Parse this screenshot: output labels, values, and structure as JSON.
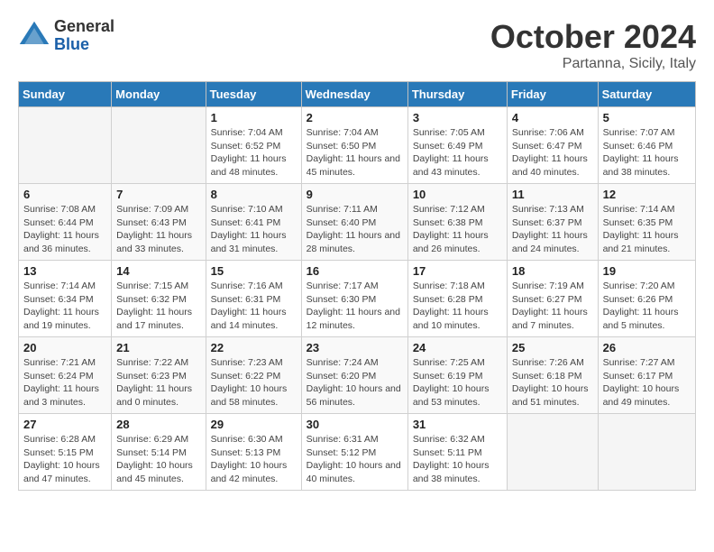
{
  "logo": {
    "general": "General",
    "blue": "Blue"
  },
  "title": "October 2024",
  "subtitle": "Partanna, Sicily, Italy",
  "headers": [
    "Sunday",
    "Monday",
    "Tuesday",
    "Wednesday",
    "Thursday",
    "Friday",
    "Saturday"
  ],
  "weeks": [
    [
      {
        "day": "",
        "info": ""
      },
      {
        "day": "",
        "info": ""
      },
      {
        "day": "1",
        "info": "Sunrise: 7:04 AM\nSunset: 6:52 PM\nDaylight: 11 hours and 48 minutes."
      },
      {
        "day": "2",
        "info": "Sunrise: 7:04 AM\nSunset: 6:50 PM\nDaylight: 11 hours and 45 minutes."
      },
      {
        "day": "3",
        "info": "Sunrise: 7:05 AM\nSunset: 6:49 PM\nDaylight: 11 hours and 43 minutes."
      },
      {
        "day": "4",
        "info": "Sunrise: 7:06 AM\nSunset: 6:47 PM\nDaylight: 11 hours and 40 minutes."
      },
      {
        "day": "5",
        "info": "Sunrise: 7:07 AM\nSunset: 6:46 PM\nDaylight: 11 hours and 38 minutes."
      }
    ],
    [
      {
        "day": "6",
        "info": "Sunrise: 7:08 AM\nSunset: 6:44 PM\nDaylight: 11 hours and 36 minutes."
      },
      {
        "day": "7",
        "info": "Sunrise: 7:09 AM\nSunset: 6:43 PM\nDaylight: 11 hours and 33 minutes."
      },
      {
        "day": "8",
        "info": "Sunrise: 7:10 AM\nSunset: 6:41 PM\nDaylight: 11 hours and 31 minutes."
      },
      {
        "day": "9",
        "info": "Sunrise: 7:11 AM\nSunset: 6:40 PM\nDaylight: 11 hours and 28 minutes."
      },
      {
        "day": "10",
        "info": "Sunrise: 7:12 AM\nSunset: 6:38 PM\nDaylight: 11 hours and 26 minutes."
      },
      {
        "day": "11",
        "info": "Sunrise: 7:13 AM\nSunset: 6:37 PM\nDaylight: 11 hours and 24 minutes."
      },
      {
        "day": "12",
        "info": "Sunrise: 7:14 AM\nSunset: 6:35 PM\nDaylight: 11 hours and 21 minutes."
      }
    ],
    [
      {
        "day": "13",
        "info": "Sunrise: 7:14 AM\nSunset: 6:34 PM\nDaylight: 11 hours and 19 minutes."
      },
      {
        "day": "14",
        "info": "Sunrise: 7:15 AM\nSunset: 6:32 PM\nDaylight: 11 hours and 17 minutes."
      },
      {
        "day": "15",
        "info": "Sunrise: 7:16 AM\nSunset: 6:31 PM\nDaylight: 11 hours and 14 minutes."
      },
      {
        "day": "16",
        "info": "Sunrise: 7:17 AM\nSunset: 6:30 PM\nDaylight: 11 hours and 12 minutes."
      },
      {
        "day": "17",
        "info": "Sunrise: 7:18 AM\nSunset: 6:28 PM\nDaylight: 11 hours and 10 minutes."
      },
      {
        "day": "18",
        "info": "Sunrise: 7:19 AM\nSunset: 6:27 PM\nDaylight: 11 hours and 7 minutes."
      },
      {
        "day": "19",
        "info": "Sunrise: 7:20 AM\nSunset: 6:26 PM\nDaylight: 11 hours and 5 minutes."
      }
    ],
    [
      {
        "day": "20",
        "info": "Sunrise: 7:21 AM\nSunset: 6:24 PM\nDaylight: 11 hours and 3 minutes."
      },
      {
        "day": "21",
        "info": "Sunrise: 7:22 AM\nSunset: 6:23 PM\nDaylight: 11 hours and 0 minutes."
      },
      {
        "day": "22",
        "info": "Sunrise: 7:23 AM\nSunset: 6:22 PM\nDaylight: 10 hours and 58 minutes."
      },
      {
        "day": "23",
        "info": "Sunrise: 7:24 AM\nSunset: 6:20 PM\nDaylight: 10 hours and 56 minutes."
      },
      {
        "day": "24",
        "info": "Sunrise: 7:25 AM\nSunset: 6:19 PM\nDaylight: 10 hours and 53 minutes."
      },
      {
        "day": "25",
        "info": "Sunrise: 7:26 AM\nSunset: 6:18 PM\nDaylight: 10 hours and 51 minutes."
      },
      {
        "day": "26",
        "info": "Sunrise: 7:27 AM\nSunset: 6:17 PM\nDaylight: 10 hours and 49 minutes."
      }
    ],
    [
      {
        "day": "27",
        "info": "Sunrise: 6:28 AM\nSunset: 5:15 PM\nDaylight: 10 hours and 47 minutes."
      },
      {
        "day": "28",
        "info": "Sunrise: 6:29 AM\nSunset: 5:14 PM\nDaylight: 10 hours and 45 minutes."
      },
      {
        "day": "29",
        "info": "Sunrise: 6:30 AM\nSunset: 5:13 PM\nDaylight: 10 hours and 42 minutes."
      },
      {
        "day": "30",
        "info": "Sunrise: 6:31 AM\nSunset: 5:12 PM\nDaylight: 10 hours and 40 minutes."
      },
      {
        "day": "31",
        "info": "Sunrise: 6:32 AM\nSunset: 5:11 PM\nDaylight: 10 hours and 38 minutes."
      },
      {
        "day": "",
        "info": ""
      },
      {
        "day": "",
        "info": ""
      }
    ]
  ]
}
